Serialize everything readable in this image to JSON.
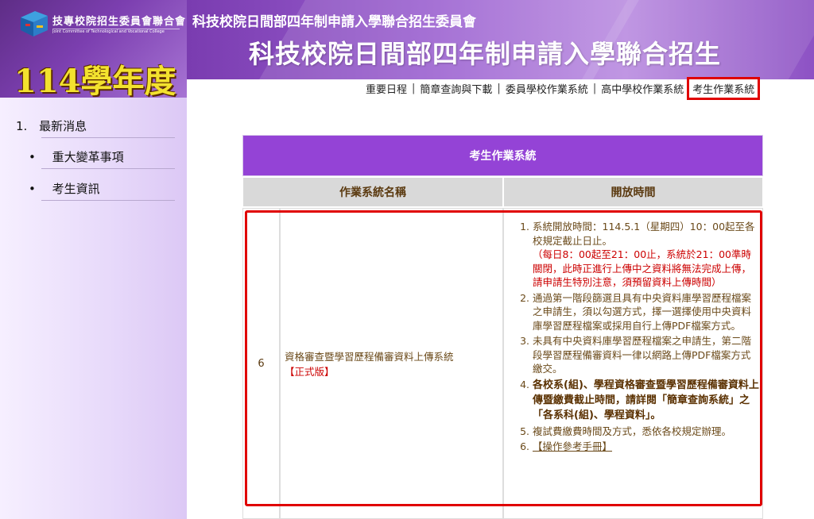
{
  "header": {
    "committee_logo_text": "技專校院招生委員會聯合會",
    "committee_logo_subtext": "Joint Committee of Technological and Vocational College Admission",
    "year_label": "114學年度",
    "small_title": "科技校院日間部四年制申請入學聯合招生委員會",
    "big_title": "科技校院日間部四年制申請入學聯合招生"
  },
  "topnav": {
    "items": [
      "重要日程",
      "簡章查詢與下載",
      "委員學校作業系統",
      "高中學校作業系統",
      "考生作業系統"
    ],
    "separator": "|",
    "active": "考生作業系統"
  },
  "sidebar": {
    "main_item_number": "1.",
    "main_item_label": "最新消息",
    "sub_items": [
      "重大變革事項",
      "考生資訊"
    ]
  },
  "table": {
    "title": "考生作業系統",
    "col_name": "作業系統名稱",
    "col_time": "開放時間",
    "row": {
      "number": "6",
      "name": "資格審查暨學習歷程備審資料上傳系統",
      "tag": "【正式版】",
      "items": [
        {
          "text": "系統開放時間：114.5.1（星期四）10：00起至各校規定截止日止。",
          "note": "（每日8：00起至21：00止，系統於21：00準時關閉，此時正進行上傳中之資料將無法完成上傳，請申請生特別注意，須預留資料上傳時間）"
        },
        {
          "text": "通過第一階段篩選且具有中央資料庫學習歷程檔案之申請生，須以勾選方式，擇一選擇使用中央資料庫學習歷程檔案或採用自行上傳PDF檔案方式。"
        },
        {
          "text": "未具有中央資料庫學習歷程檔案之申請生，第二階段學習歷程備審資料一律以網路上傳PDF檔案方式繳交。"
        },
        {
          "text": "各校系(組)、學程資格審查暨學習歷程備審資料上傳暨繳費截止時間，請詳閱「簡章查詢系統」之「各系科(組)、學程資料」。"
        },
        {
          "text": "複試費繳費時間及方式，悉依各校規定辦理。"
        },
        {
          "text": "【操作參考手冊】"
        }
      ]
    }
  },
  "colors": {
    "accent_purple": "#9443d6",
    "highlight_red": "#e00000",
    "year_gold": "#f3e22e"
  }
}
